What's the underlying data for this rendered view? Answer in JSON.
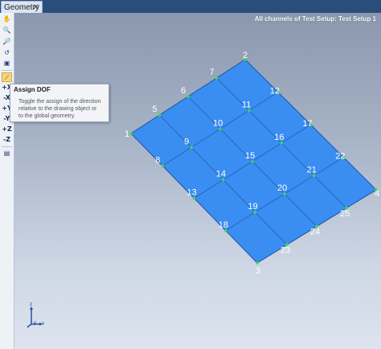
{
  "tab": {
    "label": "Geometry",
    "close": "✕"
  },
  "header": {
    "title": "All channels of Test Setup: Test Setup 1"
  },
  "toolbar": {
    "dof_labels": [
      "+X",
      "-X",
      "+Y",
      "-Y",
      "+Z",
      "-Z"
    ]
  },
  "tooltip": {
    "title": "Assign DOF",
    "line1": "Toggle the assign of the direction",
    "line2": "relative to the drawing object or",
    "line3": "to the global geometry."
  },
  "geometry": {
    "colors": {
      "surface": "#3a8ef2",
      "edge": "#2a60b8",
      "node": "#39e03f"
    },
    "rows": [
      [
        "1",
        "5",
        "6",
        "7",
        "2"
      ],
      [
        "8",
        "9",
        "10",
        "11",
        "12"
      ],
      [
        "13",
        "14",
        "15",
        "16",
        "17"
      ],
      [
        "18",
        "19",
        "20",
        "21",
        "22"
      ],
      [
        "3",
        "23",
        "24",
        "25",
        "4"
      ]
    ]
  },
  "axes": {
    "z": "z",
    "y": "y",
    "x": "x"
  }
}
